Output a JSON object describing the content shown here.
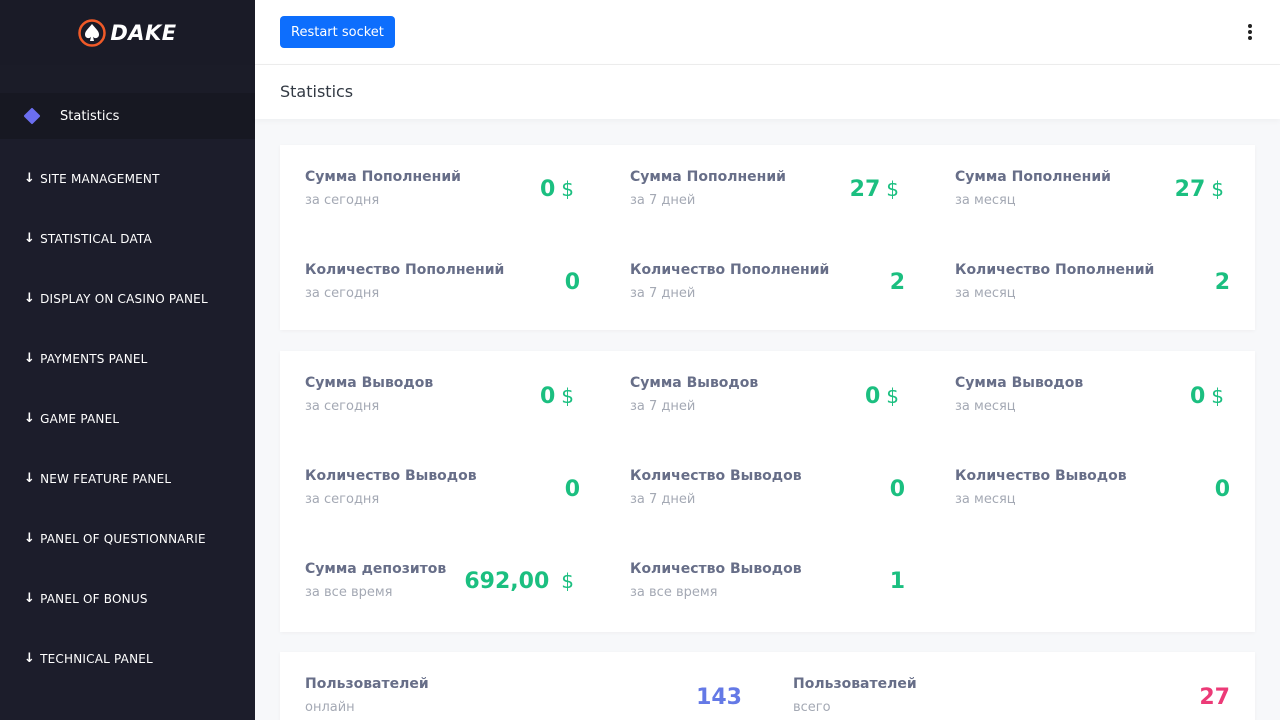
{
  "brand": {
    "name": "DAKE"
  },
  "sidebar": {
    "active_item": "Statistics",
    "sections": [
      "SITE MANAGEMENT",
      "STATISTICAL DATA",
      "DISPLAY ON CASINO PANEL",
      "PAYMENTS PANEL",
      "GAME PANEL",
      "NEW FEATURE PANEL",
      "PANEL OF QUESTIONNARIE",
      "PANEL OF BONUS",
      "TECHNICAL PANEL"
    ],
    "arrow": "↓"
  },
  "header": {
    "restart_label": "Restart socket",
    "menu_icon": "kebab-menu-icon"
  },
  "page": {
    "title": "Statistics"
  },
  "currency": "$",
  "deposits": [
    {
      "title": "Сумма Пополнений",
      "period": "за сегодня",
      "value": "0",
      "currency": true
    },
    {
      "title": "Сумма Пополнений",
      "period": "за 7 дней",
      "value": "27",
      "currency": true
    },
    {
      "title": "Сумма Пополнений",
      "period": "за месяц",
      "value": "27",
      "currency": true
    },
    {
      "title": "Количество Пополнений",
      "period": "за сегодня",
      "value": "0",
      "currency": false
    },
    {
      "title": "Количество Пополнений",
      "period": "за 7 дней",
      "value": "2",
      "currency": false
    },
    {
      "title": "Количество Пополнений",
      "period": "за месяц",
      "value": "2",
      "currency": false
    }
  ],
  "withdrawals": [
    {
      "title": "Сумма Выводов",
      "period": "за сегодня",
      "value": "0",
      "currency": true
    },
    {
      "title": "Сумма Выводов",
      "period": "за 7 дней",
      "value": "0",
      "currency": true
    },
    {
      "title": "Сумма Выводов",
      "period": "за месяц",
      "value": "0",
      "currency": true
    },
    {
      "title": "Количество Выводов",
      "period": "за сегодня",
      "value": "0",
      "currency": false
    },
    {
      "title": "Количество Выводов",
      "period": "за 7 дней",
      "value": "0",
      "currency": false
    },
    {
      "title": "Количество Выводов",
      "period": "за месяц",
      "value": "0",
      "currency": false
    },
    {
      "title": "Сумма депозитов",
      "period": "за все время",
      "value": "692,00",
      "currency": true
    },
    {
      "title": "Количество Выводов",
      "period": "за все время",
      "value": "1",
      "currency": false
    }
  ],
  "users": [
    {
      "title": "Пользователей",
      "period": "онлайн",
      "value": "143",
      "color": "#6479e6"
    },
    {
      "title": "Пользователей",
      "period": "всего",
      "value": "27",
      "color": "#ec3a77"
    }
  ],
  "colors": {
    "sidebar": "#1c1d2b",
    "accent_button": "#0d6efd",
    "value_green": "#1bbf80",
    "value_blue": "#6479e6",
    "value_pink": "#ec3a77"
  }
}
